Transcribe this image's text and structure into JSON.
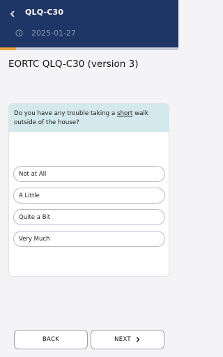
{
  "header": {
    "title": "QLQ-C30",
    "date": "2025-01-27",
    "back_icon": "chevron-left-icon",
    "info_icon": "info-icon"
  },
  "progress": {
    "fraction": 0.09,
    "color": "#f0a23a"
  },
  "form": {
    "title": "EORTC QLQ-C30 (version 3)"
  },
  "question": {
    "before": "Do you have any trouble taking a ",
    "emphasis": "short",
    "after": " walk outside of the house?"
  },
  "options": [
    "Not at All",
    "A Little",
    "Quite a Bit",
    "Very Much"
  ],
  "nav": {
    "back_label": "BACK",
    "next_label": "NEXT",
    "next_icon": "chevron-right-icon"
  },
  "colors": {
    "header": "#1f3566",
    "question_bg": "#d3e9ec"
  }
}
